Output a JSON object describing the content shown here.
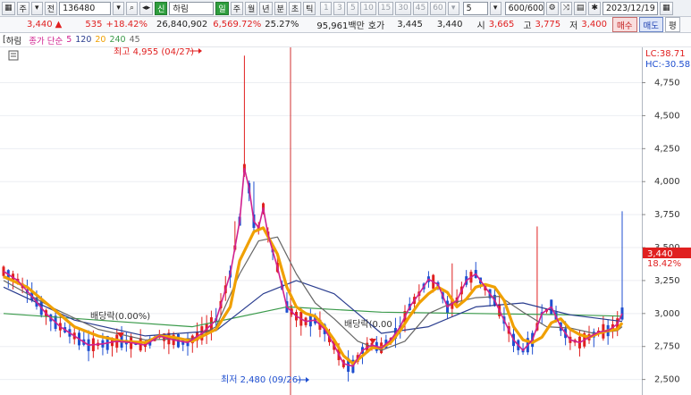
{
  "toolbar": {
    "code_type": "주",
    "jeon": "전",
    "code": "136480",
    "shin_badge": "신",
    "name": "하림",
    "yang_badge": "일",
    "period_tabs": [
      "주",
      "월",
      "년",
      "분",
      "초",
      "틱"
    ],
    "minute_buttons": [
      "1",
      "3",
      "5",
      "10",
      "15",
      "30",
      "45",
      "60"
    ],
    "interval_value": "5",
    "count_value": "600/600",
    "date_value": "2023/12/19"
  },
  "info": {
    "price": "3,440",
    "change": "535",
    "change_pct": "+18.42%",
    "volume": "26,840,902",
    "volume_pct": "6,569.72%",
    "turnover": "25.27%",
    "amount": "95,961백만",
    "quote_label": "호가",
    "ask": "3,445",
    "bid": "3,440",
    "open_label": "시",
    "open": "3,665",
    "high_label": "고",
    "high": "3,775",
    "low_label": "저",
    "low": "3,400",
    "buy_label": "매수",
    "sell_label": "매도",
    "avg_label": "평"
  },
  "legend": {
    "name": "하림",
    "ma_label": "종가 단순",
    "ma_periods": [
      "5",
      "120",
      "20",
      "240",
      "45"
    ]
  },
  "colors": {
    "ma5": "#d0208f",
    "ma20": "#f0a000",
    "ma45": "#666666",
    "ma120": "#2a3d8f",
    "ma240": "#3a9a4a",
    "up": "#e02020",
    "down": "#1f4fd0",
    "vline": "#d23030"
  },
  "chart_data": {
    "type": "candlestick",
    "ylim": [
      2450,
      4950
    ],
    "yticks": [
      "4,750",
      "4,500",
      "4,250",
      "4,000",
      "3,750",
      "3,500",
      "3,250",
      "3,000",
      "2,750",
      "2,500"
    ],
    "yvalues": [
      4750,
      4500,
      4250,
      4000,
      3750,
      3500,
      3250,
      3000,
      2750,
      2500
    ],
    "lc_label": "LC:38.71",
    "hc_label": "HC:-30.58",
    "current_price": 3440,
    "current_price_label": "3,440",
    "current_pct_label": "18.42%",
    "high_annotation": "최고 4,955 (04/27)",
    "low_annotation": "최저 2,480 (09/26)",
    "dividend_labels": [
      "배당락(0.00%)",
      "배당락(0.00"
    ],
    "ma20_points": [
      [
        0,
        3280
      ],
      [
        5,
        3200
      ],
      [
        10,
        3050
      ],
      [
        15,
        2900
      ],
      [
        20,
        2830
      ],
      [
        25,
        2790
      ],
      [
        30,
        2780
      ],
      [
        33,
        2830
      ],
      [
        36,
        2820
      ],
      [
        40,
        2790
      ],
      [
        45,
        2880
      ],
      [
        48,
        3050
      ],
      [
        50,
        3400
      ],
      [
        53,
        3620
      ],
      [
        55,
        3650
      ],
      [
        58,
        3450
      ],
      [
        60,
        3200
      ],
      [
        62,
        3050
      ],
      [
        64,
        3000
      ],
      [
        66,
        2980
      ],
      [
        68,
        2900
      ],
      [
        70,
        2800
      ],
      [
        72,
        2680
      ],
      [
        74,
        2620
      ],
      [
        76,
        2680
      ],
      [
        78,
        2740
      ],
      [
        80,
        2740
      ],
      [
        82,
        2780
      ],
      [
        84,
        2870
      ],
      [
        86,
        2980
      ],
      [
        88,
        3080
      ],
      [
        90,
        3150
      ],
      [
        92,
        3200
      ],
      [
        94,
        3160
      ],
      [
        96,
        3050
      ],
      [
        98,
        3110
      ],
      [
        100,
        3200
      ],
      [
        102,
        3220
      ],
      [
        104,
        3200
      ],
      [
        106,
        3100
      ],
      [
        108,
        2900
      ],
      [
        110,
        2800
      ],
      [
        112,
        2780
      ],
      [
        114,
        2820
      ],
      [
        116,
        2930
      ],
      [
        118,
        2960
      ],
      [
        120,
        2880
      ],
      [
        122,
        2840
      ],
      [
        124,
        2820
      ],
      [
        126,
        2850
      ],
      [
        128,
        2870
      ],
      [
        130,
        2880
      ],
      [
        131,
        2930
      ]
    ],
    "ma45_points": [
      [
        0,
        3250
      ],
      [
        10,
        3050
      ],
      [
        20,
        2880
      ],
      [
        30,
        2800
      ],
      [
        40,
        2810
      ],
      [
        45,
        2900
      ],
      [
        50,
        3300
      ],
      [
        54,
        3550
      ],
      [
        58,
        3580
      ],
      [
        62,
        3300
      ],
      [
        66,
        3080
      ],
      [
        70,
        2960
      ],
      [
        75,
        2790
      ],
      [
        80,
        2720
      ],
      [
        85,
        2790
      ],
      [
        90,
        3000
      ],
      [
        95,
        3080
      ],
      [
        100,
        3120
      ],
      [
        105,
        3130
      ],
      [
        110,
        3010
      ],
      [
        115,
        2900
      ],
      [
        120,
        2890
      ],
      [
        125,
        2850
      ],
      [
        130,
        2870
      ],
      [
        131,
        2900
      ]
    ],
    "ma120_points": [
      [
        0,
        3200
      ],
      [
        15,
        2950
      ],
      [
        30,
        2830
      ],
      [
        45,
        2870
      ],
      [
        55,
        3150
      ],
      [
        62,
        3250
      ],
      [
        70,
        3150
      ],
      [
        80,
        2850
      ],
      [
        90,
        2900
      ],
      [
        100,
        3050
      ],
      [
        110,
        3080
      ],
      [
        120,
        2990
      ],
      [
        131,
        2940
      ]
    ],
    "ma240_points": [
      [
        0,
        3000
      ],
      [
        20,
        2950
      ],
      [
        40,
        2900
      ],
      [
        60,
        3050
      ],
      [
        80,
        3010
      ],
      [
        100,
        3000
      ],
      [
        120,
        2990
      ],
      [
        131,
        2980
      ]
    ],
    "ma5_points": [
      [
        0,
        3320
      ],
      [
        3,
        3250
      ],
      [
        6,
        3130
      ],
      [
        9,
        3000
      ],
      [
        12,
        2900
      ],
      [
        15,
        2830
      ],
      [
        18,
        2760
      ],
      [
        21,
        2770
      ],
      [
        24,
        2790
      ],
      [
        27,
        2780
      ],
      [
        30,
        2760
      ],
      [
        33,
        2830
      ],
      [
        36,
        2800
      ],
      [
        39,
        2780
      ],
      [
        42,
        2850
      ],
      [
        45,
        2950
      ],
      [
        48,
        3300
      ],
      [
        50,
        3700
      ],
      [
        51,
        4100
      ],
      [
        52,
        3950
      ],
      [
        53,
        3700
      ],
      [
        54,
        3650
      ],
      [
        55,
        3800
      ],
      [
        56,
        3600
      ],
      [
        58,
        3350
      ],
      [
        60,
        3050
      ],
      [
        62,
        2980
      ],
      [
        64,
        2940
      ],
      [
        66,
        2950
      ],
      [
        68,
        2880
      ],
      [
        70,
        2760
      ],
      [
        72,
        2620
      ],
      [
        74,
        2600
      ],
      [
        76,
        2720
      ],
      [
        78,
        2760
      ],
      [
        80,
        2740
      ],
      [
        82,
        2800
      ],
      [
        84,
        2900
      ],
      [
        86,
        3050
      ],
      [
        88,
        3150
      ],
      [
        90,
        3260
      ],
      [
        92,
        3220
      ],
      [
        94,
        3050
      ],
      [
        96,
        3100
      ],
      [
        98,
        3250
      ],
      [
        100,
        3300
      ],
      [
        102,
        3200
      ],
      [
        104,
        3100
      ],
      [
        106,
        2950
      ],
      [
        108,
        2800
      ],
      [
        110,
        2720
      ],
      [
        112,
        2800
      ],
      [
        114,
        3000
      ],
      [
        116,
        3050
      ],
      [
        118,
        2900
      ],
      [
        120,
        2800
      ],
      [
        122,
        2780
      ],
      [
        124,
        2820
      ],
      [
        126,
        2860
      ],
      [
        128,
        2870
      ],
      [
        130,
        2920
      ],
      [
        131,
        3000
      ]
    ],
    "spikes": [
      [
        49,
        3700
      ],
      [
        51,
        4955
      ],
      [
        53,
        4000
      ],
      [
        95,
        3380
      ],
      [
        98,
        3330
      ],
      [
        113,
        3660
      ],
      [
        131,
        3775
      ]
    ]
  }
}
